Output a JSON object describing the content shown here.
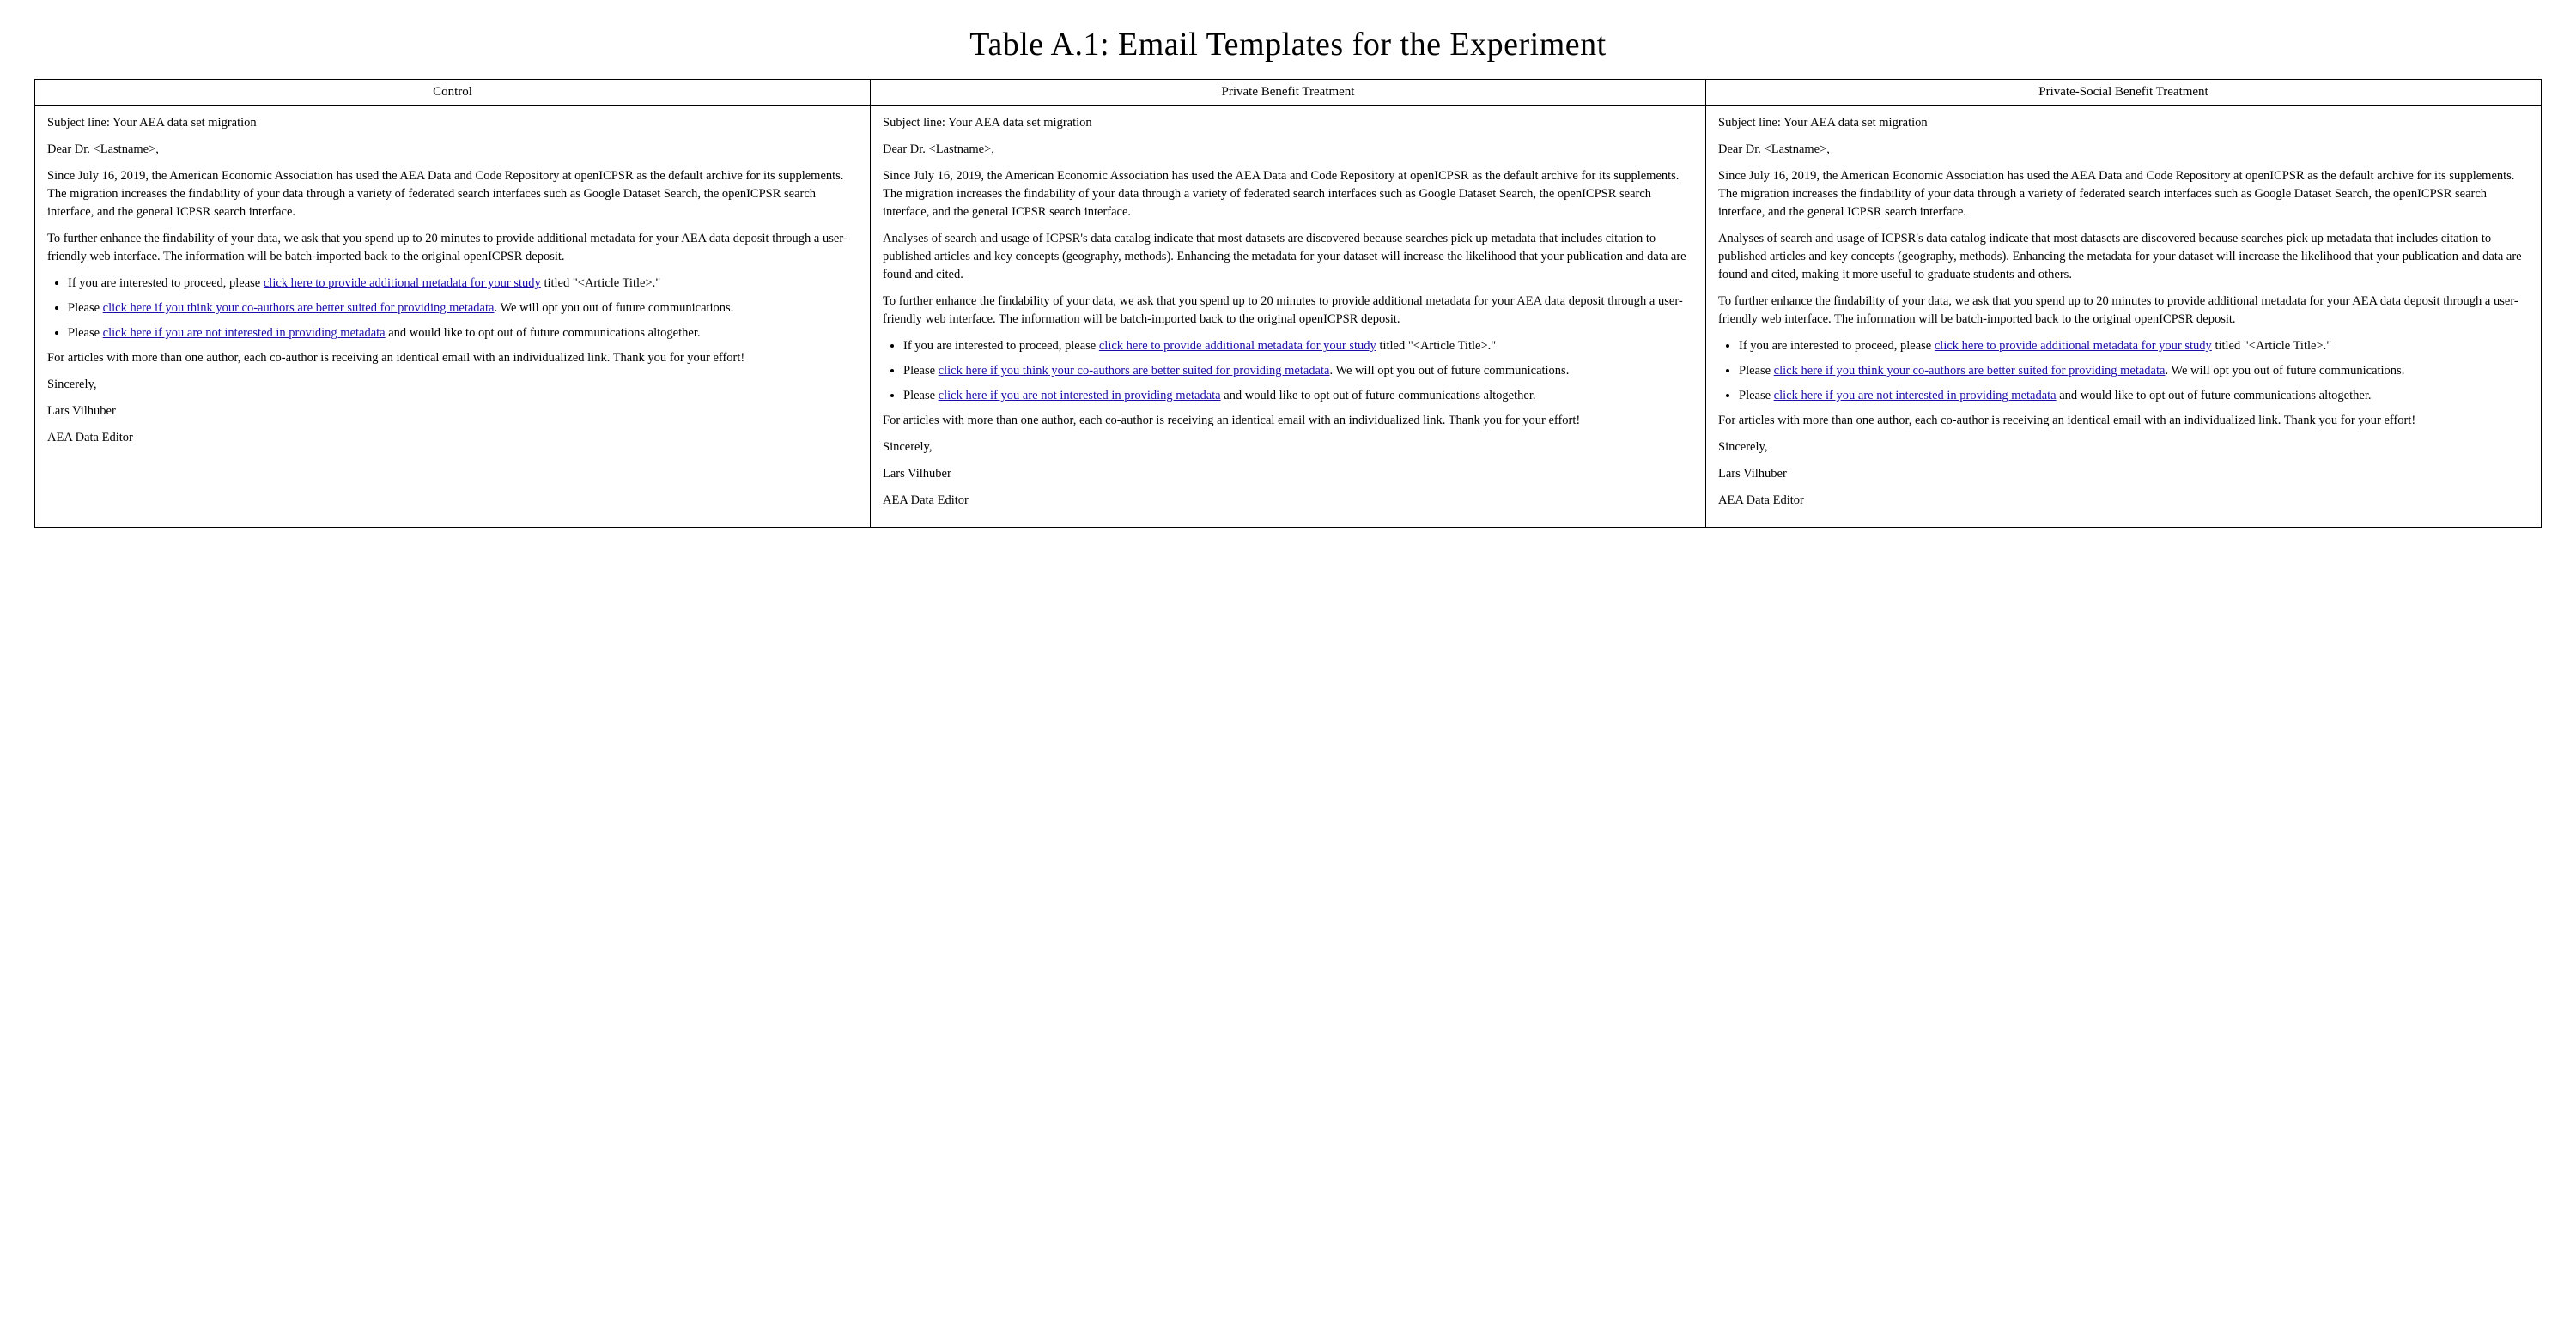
{
  "title": "Table A.1: Email Templates for the Experiment",
  "columns": [
    "Control",
    "Private Benefit Treatment",
    "Private-Social Benefit Treatment"
  ],
  "cells": {
    "control": {
      "subject": "Subject line: Your AEA data set migration",
      "greeting": "Dear Dr. <Lastname>,",
      "para1": "Since July 16, 2019, the American Economic Association has used the AEA Data and Code Repository at openICPSR as the default archive for its supplements. The migration increases the findability of your data through a variety of federated search interfaces such as Google Dataset Search, the openICPSR search interface, and the general ICPSR search interface.",
      "para2": "To further enhance the findability of your data, we ask that you spend up to 20 minutes to provide additional metadata for your AEA data deposit through a user-friendly web interface.  The information will be batch-imported back to the original openICPSR deposit.",
      "bullet1_pre": "If you are interested to proceed, please ",
      "bullet1_link": "click here to provide additional metadata for your study",
      "bullet1_post": " titled \"<Article Title>.\"",
      "bullet2_pre": "Please ",
      "bullet2_link": "click here if you think your co-authors are better suited for providing metadata",
      "bullet2_post": ".  We will opt you out of future communications.",
      "bullet3_pre": "Please ",
      "bullet3_link": "click here if you are not interested in providing metadata",
      "bullet3_post": " and would like to opt out of future communications altogether.",
      "para3": "For articles with more than one author, each co-author is receiving an identical email with an individualized link. Thank you for your effort!",
      "sincerely": "Sincerely,",
      "name": "Lars Vilhuber",
      "title_sig": "AEA Data Editor"
    },
    "private": {
      "subject": "Subject line: Your AEA data set migration",
      "greeting": "Dear Dr. <Lastname>,",
      "para1": "Since July 16, 2019, the American Economic Association has used the AEA Data and Code Repository at openICPSR as the default archive for its supplements. The migration increases the findability of your data through a variety of federated search interfaces such as Google Dataset Search, the openICPSR search interface, and the general ICPSR search interface.",
      "para2": "Analyses of search and usage of ICPSR's data catalog indicate that most datasets are discovered because searches pick up metadata that includes citation to published articles and key concepts (geography, methods). Enhancing the metadata for your dataset will increase the likelihood that your publication and data are found and cited.",
      "para3": "To further enhance the findability of your data, we ask that you spend up to 20 minutes to provide additional metadata for your AEA data deposit through a user-friendly web interface.  The information will be batch-imported back to the original openICPSR deposit.",
      "bullet1_pre": "If you are interested to proceed, please ",
      "bullet1_link": "click here to provide additional metadata for your study",
      "bullet1_post": " titled \"<Article Title>.\"",
      "bullet2_pre": "Please ",
      "bullet2_link": "click here if you think your co-authors are better suited for providing metadata",
      "bullet2_post": ".  We will opt you out of future communications.",
      "bullet3_pre": "Please ",
      "bullet3_link": "click here if you are not interested in providing metadata",
      "bullet3_post": " and would like to opt out of future communications altogether.",
      "para4": "For articles with more than one author, each co-author is receiving an identical email with an individualized link. Thank you for your effort!",
      "sincerely": "Sincerely,",
      "name": "Lars Vilhuber",
      "title_sig": "AEA Data Editor"
    },
    "social": {
      "subject": "Subject line: Your AEA data set migration",
      "greeting": "Dear Dr. <Lastname>,",
      "para1": "Since July 16, 2019, the American Economic Association has used the AEA Data and Code Repository at openICPSR as the default archive for its supplements. The migration increases the findability of your data through a variety of federated search interfaces such as Google Dataset Search, the openICPSR search interface, and the general ICPSR search interface.",
      "para2": "Analyses of search and usage of ICPSR's data catalog indicate that most datasets are discovered because searches pick up metadata that includes citation to published articles and key concepts (geography, methods). Enhancing the metadata for your dataset will increase the likelihood that your publication and data are found and cited, making it more useful to graduate students and others.",
      "para3": "To further enhance the findability of your data, we ask that you spend up to 20 minutes to provide additional metadata for your AEA data deposit through a user-friendly web interface.  The information will be batch-imported back to the original openICPSR deposit.",
      "bullet1_pre": "If you are interested to proceed, please ",
      "bullet1_link": "click here to provide additional metadata for your study",
      "bullet1_post": " titled \"<Article Title>.\"",
      "bullet2_pre": "Please ",
      "bullet2_link": "click here if you think your co-authors are better suited for providing metadata",
      "bullet2_post": ".  We will opt you out of future communications.",
      "bullet3_pre": "Please ",
      "bullet3_link": "click here if you are not interested in providing metadata",
      "bullet3_post": " and would like to opt out of future communications altogether.",
      "para4": "For articles with more than one author, each co-author is receiving an identical email with an individualized link. Thank you for your effort!",
      "sincerely": "Sincerely,",
      "name": "Lars Vilhuber",
      "title_sig": "AEA Data Editor"
    }
  }
}
